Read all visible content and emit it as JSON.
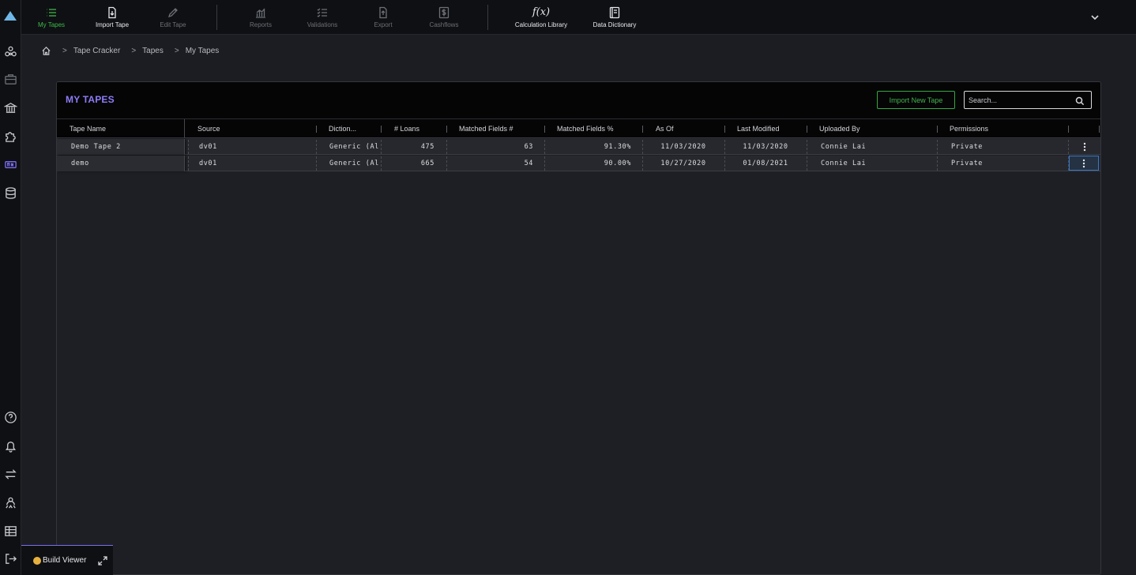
{
  "topbar": {
    "items": [
      {
        "label": "My Tapes",
        "icon": "list-icon",
        "state": "active"
      },
      {
        "label": "Import Tape",
        "icon": "import-file-icon",
        "state": "normal"
      },
      {
        "label": "Edit Tape",
        "icon": "pencil-icon",
        "state": "disabled"
      },
      {
        "label": "Reports",
        "icon": "bar-chart-icon",
        "state": "disabled"
      },
      {
        "label": "Validations",
        "icon": "checklist-icon",
        "state": "disabled"
      },
      {
        "label": "Export",
        "icon": "export-file-icon",
        "state": "disabled"
      },
      {
        "label": "Cashflows",
        "icon": "dollar-icon",
        "state": "disabled"
      },
      {
        "label": "Calculation Library",
        "icon": "function-icon",
        "glyph": "f(x)",
        "state": "normal"
      },
      {
        "label": "Data Dictionary",
        "icon": "book-icon",
        "state": "normal"
      }
    ]
  },
  "breadcrumb": [
    "Tape Cracker",
    "Tapes",
    "My Tapes"
  ],
  "breadcrumb_sep": ">",
  "panel": {
    "title": "MY TAPES",
    "import_label": "Import New Tape",
    "search_placeholder": "Search..."
  },
  "grid": {
    "columns": [
      "Tape Name",
      "Source",
      "Diction...",
      "# Loans",
      "Matched Fields #",
      "Matched Fields %",
      "As Of",
      "Last Modified",
      "Uploaded By",
      "Permissions"
    ],
    "rows": [
      {
        "name": "Demo Tape 2",
        "source": "dv01",
        "dictionary": "Generic (Al",
        "loans": "475",
        "matched": "63",
        "matched_pct": "91.30%",
        "as_of": "11/03/2020",
        "modified": "11/03/2020",
        "uploaded_by": "Connie Lai",
        "permissions": "Private"
      },
      {
        "name": "demo",
        "source": "dv01",
        "dictionary": "Generic (Al",
        "loans": "665",
        "matched": "54",
        "matched_pct": "90.00%",
        "as_of": "10/27/2020",
        "modified": "01/08/2021",
        "uploaded_by": "Connie Lai",
        "permissions": "Private"
      }
    ]
  },
  "build_viewer": {
    "label": "Build Viewer"
  },
  "colors": {
    "accent_green": "#3dbb4a",
    "accent_purple": "#8d7cf6",
    "selection_blue": "#3a78c4"
  }
}
